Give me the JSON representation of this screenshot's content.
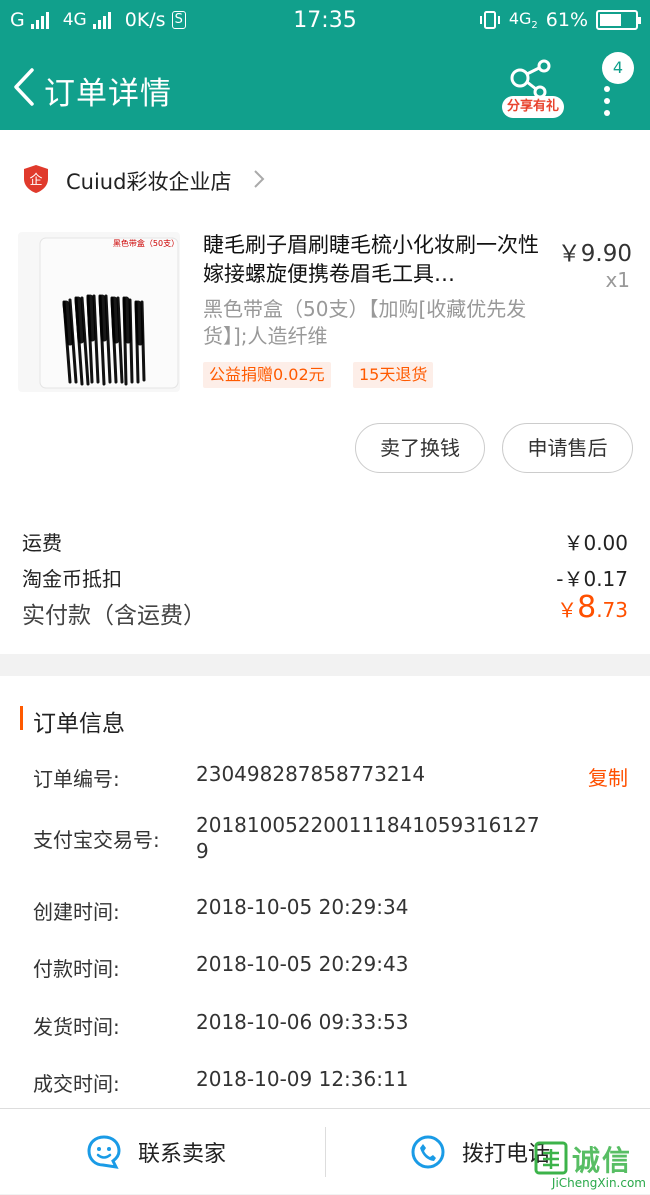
{
  "status_bar": {
    "carrier1": "G",
    "carrier2": "4G",
    "speed": "0K/s",
    "s_icon": "S",
    "time": "17:35",
    "network": "4G",
    "network_sub": "2",
    "battery": "61%",
    "battery_level": 0.61
  },
  "header": {
    "title": "订单详情",
    "share_label": "分享有礼",
    "more_badge": "4"
  },
  "store": {
    "name": "Cuiud彩妆企业店",
    "badge_text": "企"
  },
  "product": {
    "title": "睫毛刷子眉刷睫毛梳小化妆刷一次性嫁接螺旋便携卷眉毛工具…",
    "price": "￥9.90",
    "qty": "x1",
    "sku": "黑色带盒（50支）【加购[收藏优先发货】];人造纤维",
    "image_label": "黑色带盒（50支）",
    "tags": [
      "公益捐赠0.02元",
      "15天退货"
    ],
    "btn_sell": "卖了换钱",
    "btn_after_sale": "申请售后"
  },
  "fees": {
    "shipping_label": "运费",
    "shipping_value": "￥0.00",
    "coin_label": "淘金币抵扣",
    "coin_value": "-￥0.17",
    "paid_label": "实付款（含运费）",
    "paid_currency": "￥",
    "paid_int": "8",
    "paid_dec": ".73"
  },
  "order_info": {
    "section_title": "订单信息",
    "copy_label": "复制",
    "rows": [
      {
        "label": "订单编号:",
        "value": "230498287858773214"
      },
      {
        "label": "支付宝交易号:",
        "value": "2018100522001118410593161279"
      },
      {
        "label": "创建时间:",
        "value": "2018-10-05 20:29:34"
      },
      {
        "label": "付款时间:",
        "value": "2018-10-05 20:29:43"
      },
      {
        "label": "发货时间:",
        "value": "2018-10-06 09:33:53"
      },
      {
        "label": "成交时间:",
        "value": "2018-10-09 12:36:11"
      }
    ]
  },
  "bottom_bar": {
    "contact_seller": "联系卖家",
    "call_phone": "拨打电话"
  },
  "watermark": {
    "chars": "诚信",
    "site": "JiChengXin.com"
  },
  "colors": {
    "brand": "#11a08c",
    "accent_orange": "#ff5000",
    "icon_blue": "#1a9be6"
  }
}
